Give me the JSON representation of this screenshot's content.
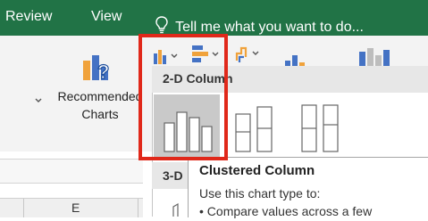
{
  "ribbon": {
    "tabs": [
      {
        "label": "Review"
      },
      {
        "label": "View"
      }
    ],
    "tell_me": {
      "placeholder": "Tell me what you want to do..."
    }
  },
  "recommended_charts": {
    "label": "Recommended Charts"
  },
  "gallery": {
    "section_2d": "2-D Column",
    "section_3d_partial": "3-D",
    "tooltip": {
      "title": "Clustered Column",
      "line1": "Use this chart type to:",
      "line2_partial": "• Compare values across a few"
    }
  },
  "sheet": {
    "column_header_partial": "E"
  },
  "colors": {
    "ribbon_green": "#217346",
    "highlight_red": "#e0281a"
  }
}
